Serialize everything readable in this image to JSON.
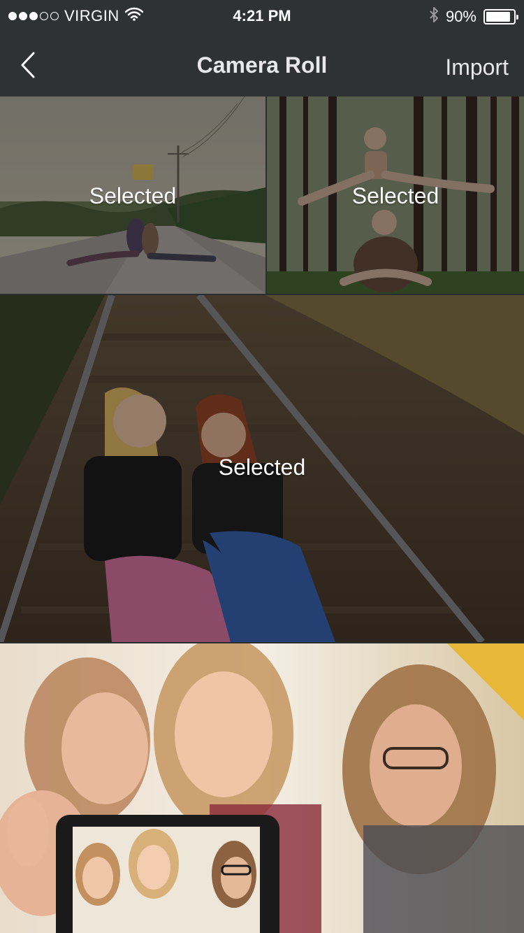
{
  "status_bar": {
    "carrier": "VIRGIN",
    "signal_bars_filled": 3,
    "signal_bars_total": 5,
    "time": "4:21 PM",
    "battery_percent": "90%",
    "battery_level": 0.9
  },
  "nav": {
    "title": "Camera Roll",
    "action_label": "Import"
  },
  "photos": [
    {
      "label": "Selected",
      "selected": true
    },
    {
      "label": "Selected",
      "selected": true
    },
    {
      "label": "Selected",
      "selected": true
    },
    {
      "label": "",
      "selected": false
    }
  ],
  "colors": {
    "header_bg": "#2f3233",
    "text": "#ffffff"
  },
  "icons": {
    "back": "chevron-left-icon",
    "wifi": "wifi-icon",
    "bluetooth": "bluetooth-icon",
    "battery": "battery-icon"
  }
}
